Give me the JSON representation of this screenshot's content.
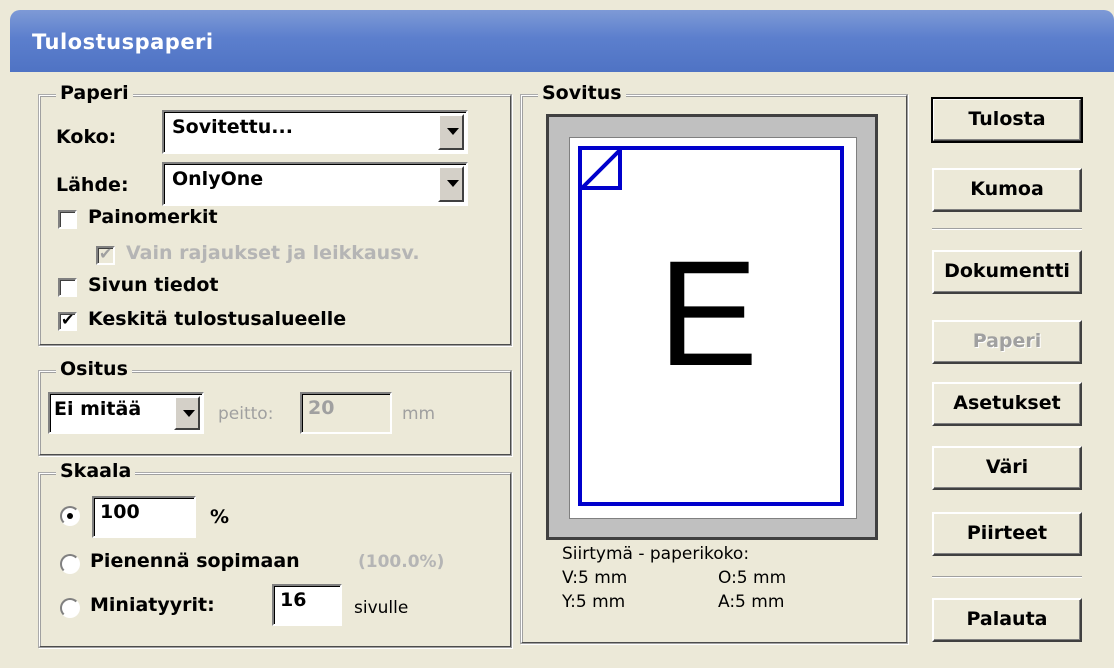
{
  "window": {
    "title": "Tulostuspaperi"
  },
  "paper": {
    "legend": "Paperi",
    "size_label": "Koko:",
    "size_value": "Sovitettu...",
    "source_label": "Lähde:",
    "source_value": "OnlyOne",
    "print_marks_label": "Painomerkit",
    "print_marks_checked": false,
    "crop_only_label": "Vain rajaukset ja leikkausv.",
    "crop_only_checked": true,
    "page_info_label": "Sivun tiedot",
    "page_info_checked": false,
    "center_label": "Keskitä tulostusalueelle",
    "center_checked": true
  },
  "tiling": {
    "legend": "Ositus",
    "mode_value": "Ei mitää",
    "overlap_label": "peitto:",
    "overlap_value": "20",
    "unit": "mm"
  },
  "scale": {
    "legend": "Skaala",
    "percent_value": "100",
    "percent_unit": "%",
    "fit_label": "Pienennä sopimaan",
    "fit_value": "(100.0%)",
    "thumbs_label": "Miniatyyrit:",
    "thumbs_value": "16",
    "thumbs_unit": "sivulle",
    "selected": "percent"
  },
  "fit": {
    "legend": "Sovitus",
    "preview_letter": "E",
    "offset_title": "Siirtymä - paperikoko:",
    "v": "V:5 mm",
    "o": "O:5 mm",
    "y": "Y:5 mm",
    "a": "A:5 mm"
  },
  "buttons": {
    "print": "Tulosta",
    "cancel": "Kumoa",
    "document": "Dokumentti",
    "paper": "Paperi",
    "settings": "Asetukset",
    "color": "Väri",
    "features": "Piirteet",
    "restore": "Palauta"
  },
  "colors": {
    "title_bar": "#5C7FCD",
    "preview_border": "#0000CC"
  }
}
